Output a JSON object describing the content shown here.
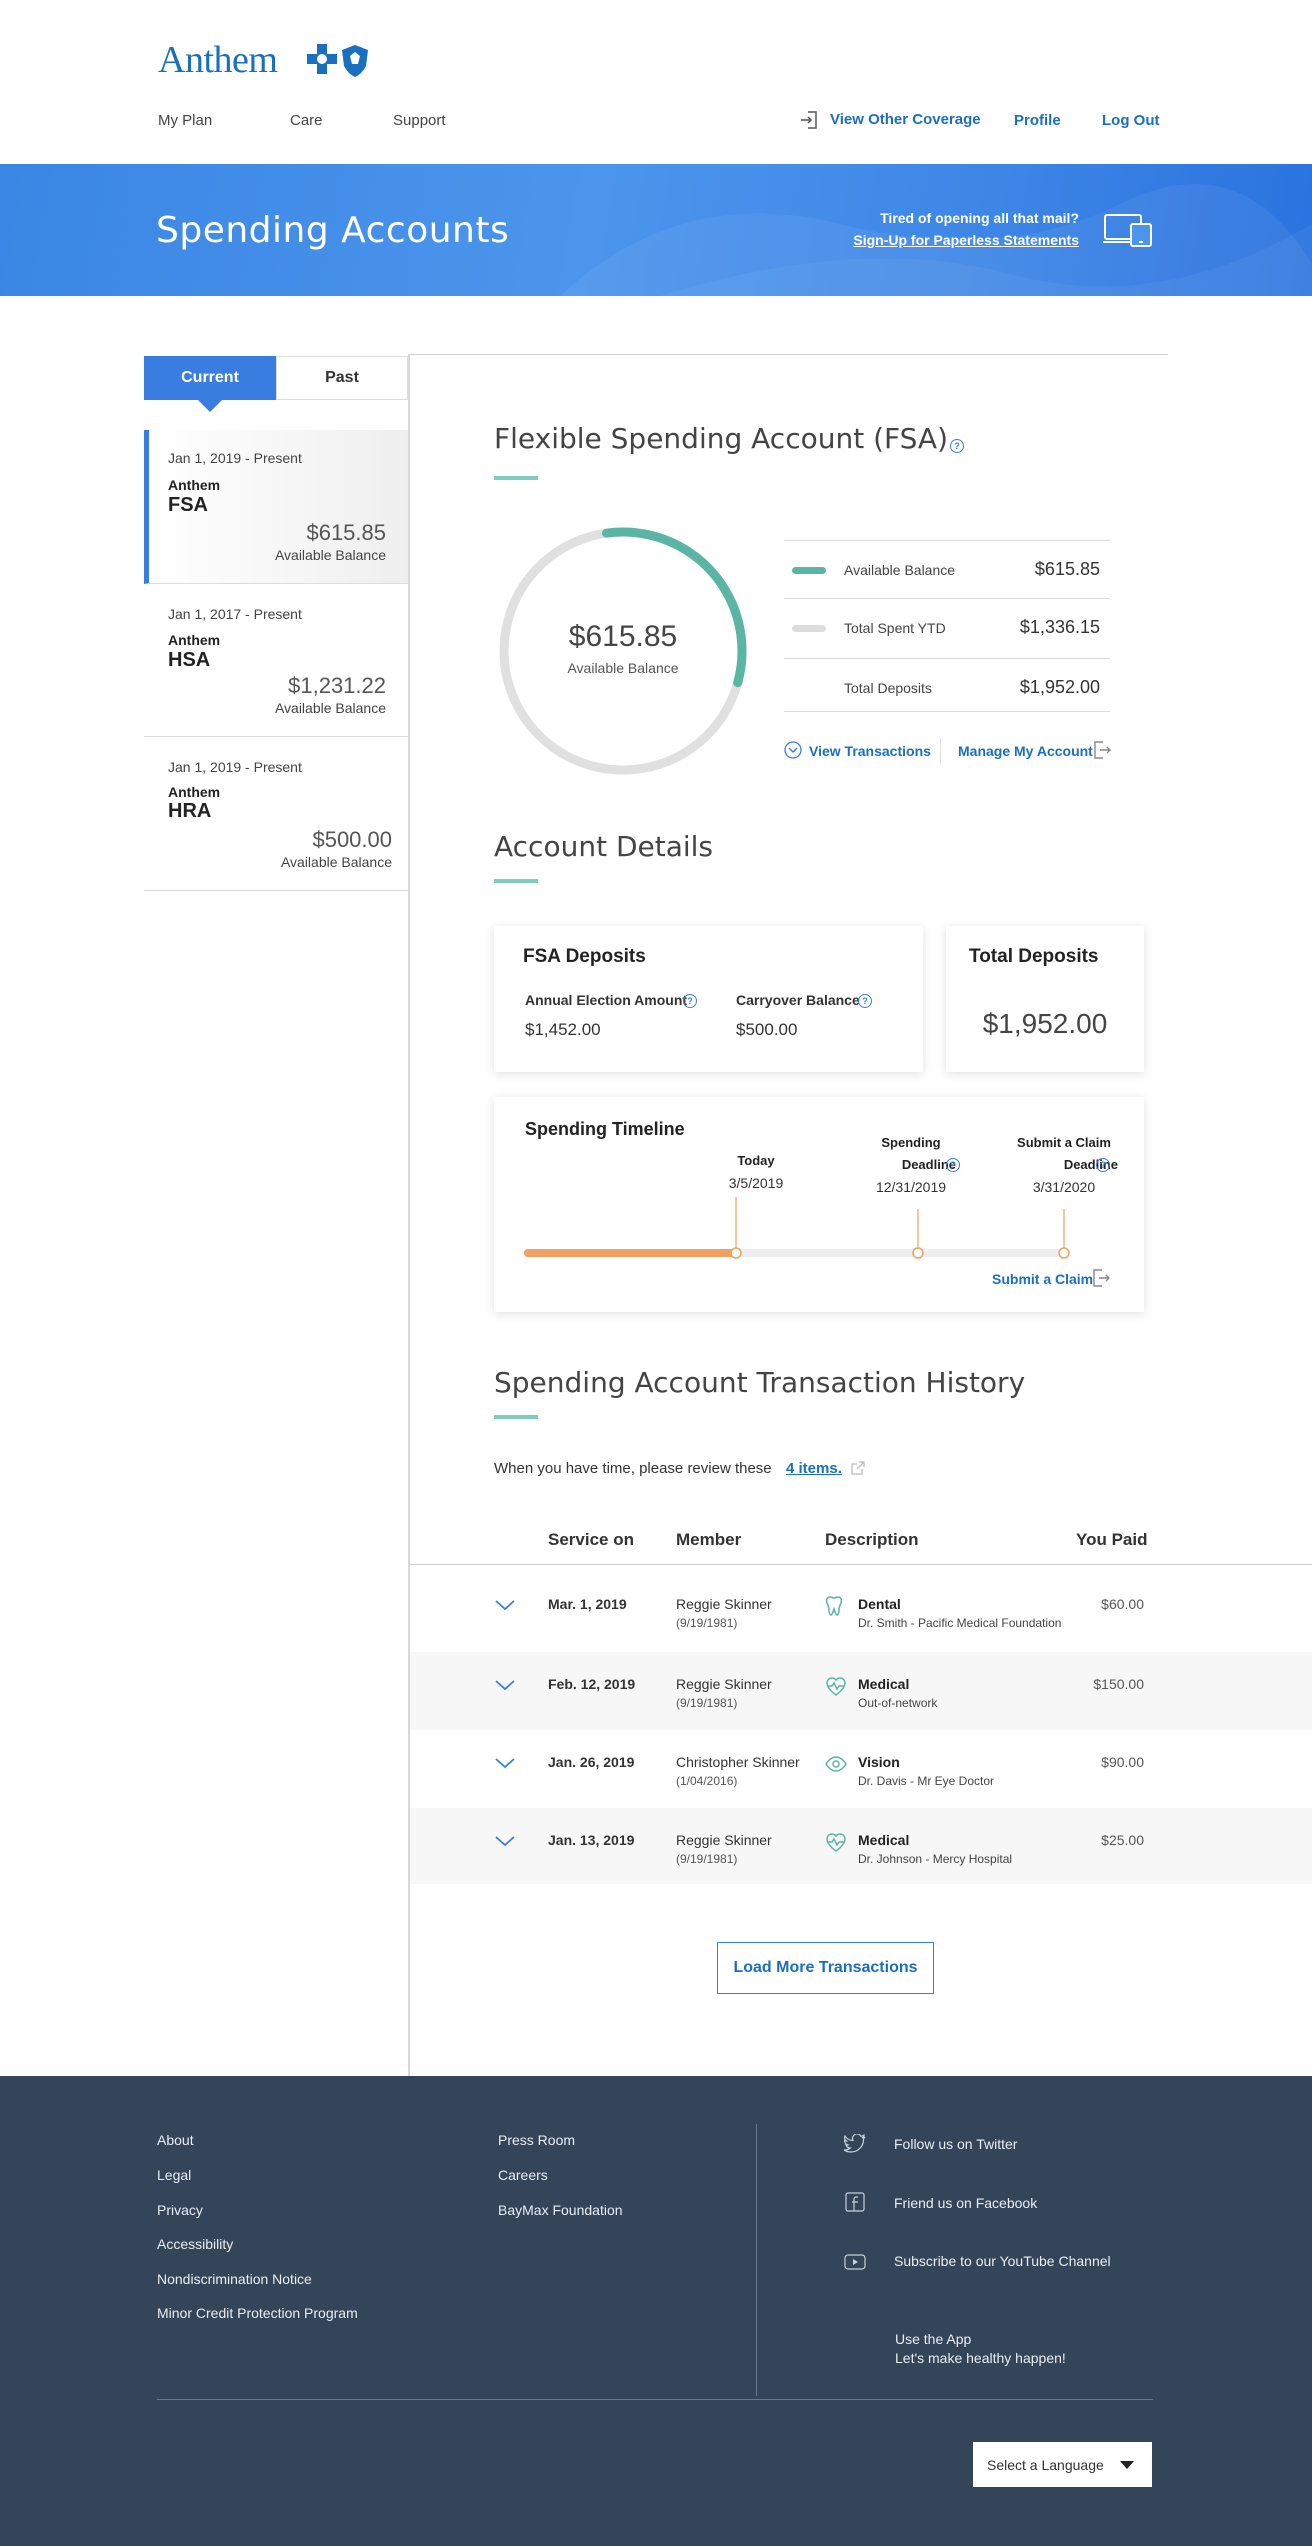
{
  "header": {
    "logo_text": "Anthem",
    "nav": [
      "My Plan",
      "Care",
      "Support"
    ],
    "view_other_coverage": "View Other Coverage",
    "profile": "Profile",
    "logout": "Log Out"
  },
  "banner": {
    "title": "Spending Accounts",
    "question": "Tired of opening all that mail?",
    "signup_link": "Sign-Up for Paperless Statements"
  },
  "sidebar": {
    "tabs": [
      "Current",
      "Past"
    ],
    "accounts": [
      {
        "date": "Jan 1, 2019 - Present",
        "brand": "Anthem",
        "type": "FSA",
        "amount": "$615.85",
        "label": "Available Balance"
      },
      {
        "date": "Jan 1, 2017 - Present",
        "brand": "Anthem",
        "type": "HSA",
        "amount": "$1,231.22",
        "label": "Available Balance"
      },
      {
        "date": "Jan 1, 2019 - Present",
        "brand": "Anthem",
        "type": "HRA",
        "amount": "$500.00",
        "label": "Available Balance"
      }
    ]
  },
  "fsa": {
    "title": "Flexible Spending Account (FSA)",
    "donut_amount": "$615.85",
    "donut_label": "Available Balance",
    "donut_available_fraction": 0.315,
    "rows": [
      {
        "label": "Available Balance",
        "value": "$615.85",
        "color": "#5bb5a4"
      },
      {
        "label": "Total Spent YTD",
        "value": "$1,336.15",
        "color": "#dddddd"
      },
      {
        "label": "Total Deposits",
        "value": "$1,952.00",
        "color": ""
      }
    ],
    "view_transactions": "View Transactions",
    "manage_account": "Manage My Account"
  },
  "details": {
    "title": "Account Details",
    "fsa_deposits": {
      "title": "FSA Deposits",
      "annual_label": "Annual Election Amount",
      "annual_value": "$1,452.00",
      "carryover_label": "Carryover Balance",
      "carryover_value": "$500.00"
    },
    "total_deposits": {
      "title": "Total Deposits",
      "value": "$1,952.00"
    },
    "timeline": {
      "title": "Spending Timeline",
      "progress_fraction": 0.39,
      "today_label": "Today",
      "today_date": "3/5/2019",
      "deadline_label_1": "Spending",
      "deadline_label_2": "Deadline",
      "deadline_date": "12/31/2019",
      "claim_label_1": "Submit a Claim",
      "claim_label_2": "Deadline",
      "claim_date": "3/31/2020",
      "submit_claim": "Submit a Claim"
    }
  },
  "history": {
    "title": "Spending Account Transaction History",
    "review_text": "When you have time, please review these",
    "review_link": "4 items.",
    "columns": [
      "Service on",
      "Member",
      "Description",
      "You Paid"
    ],
    "rows": [
      {
        "date": "Mar. 1, 2019",
        "member": "Reggie Skinner",
        "dob": "(9/19/1981)",
        "desc": "Dental",
        "sub": "Dr. Smith - Pacific Medical Foundation",
        "paid": "$60.00",
        "icon": "tooth-icon"
      },
      {
        "date": "Feb. 12, 2019",
        "member": "Reggie Skinner",
        "dob": "(9/19/1981)",
        "desc": "Medical",
        "sub": "Out-of-network",
        "paid": "$150.00",
        "icon": "heart-pulse-icon"
      },
      {
        "date": "Jan. 26, 2019",
        "member": "Christopher Skinner",
        "dob": "(1/04/2016)",
        "desc": "Vision",
        "sub": "Dr. Davis - Mr Eye Doctor",
        "paid": "$90.00",
        "icon": "eye-icon"
      },
      {
        "date": "Jan. 13, 2019",
        "member": "Reggie Skinner",
        "dob": "(9/19/1981)",
        "desc": "Medical",
        "sub": "Dr. Johnson - Mercy Hospital",
        "paid": "$25.00",
        "icon": "heart-pulse-icon"
      }
    ],
    "load_more": "Load More Transactions"
  },
  "footer": {
    "col1": [
      "About",
      "Legal",
      "Privacy",
      "Accessibility",
      "Nondiscrimination Notice",
      "Minor Credit Protection Program"
    ],
    "col2": [
      "Press Room",
      "Careers",
      "BayMax Foundation"
    ],
    "twitter": "Follow us on Twitter",
    "facebook": "Friend us on Facebook",
    "youtube": "Subscribe to our YouTube Channel",
    "app_1": "Use the App",
    "app_2": "Let's make healthy happen!",
    "language": "Select a Language"
  },
  "colors": {
    "accent_blue": "#3a7de0",
    "teal": "#5bb5a4",
    "orange": "#f0a060",
    "footer_bg": "#354559"
  }
}
